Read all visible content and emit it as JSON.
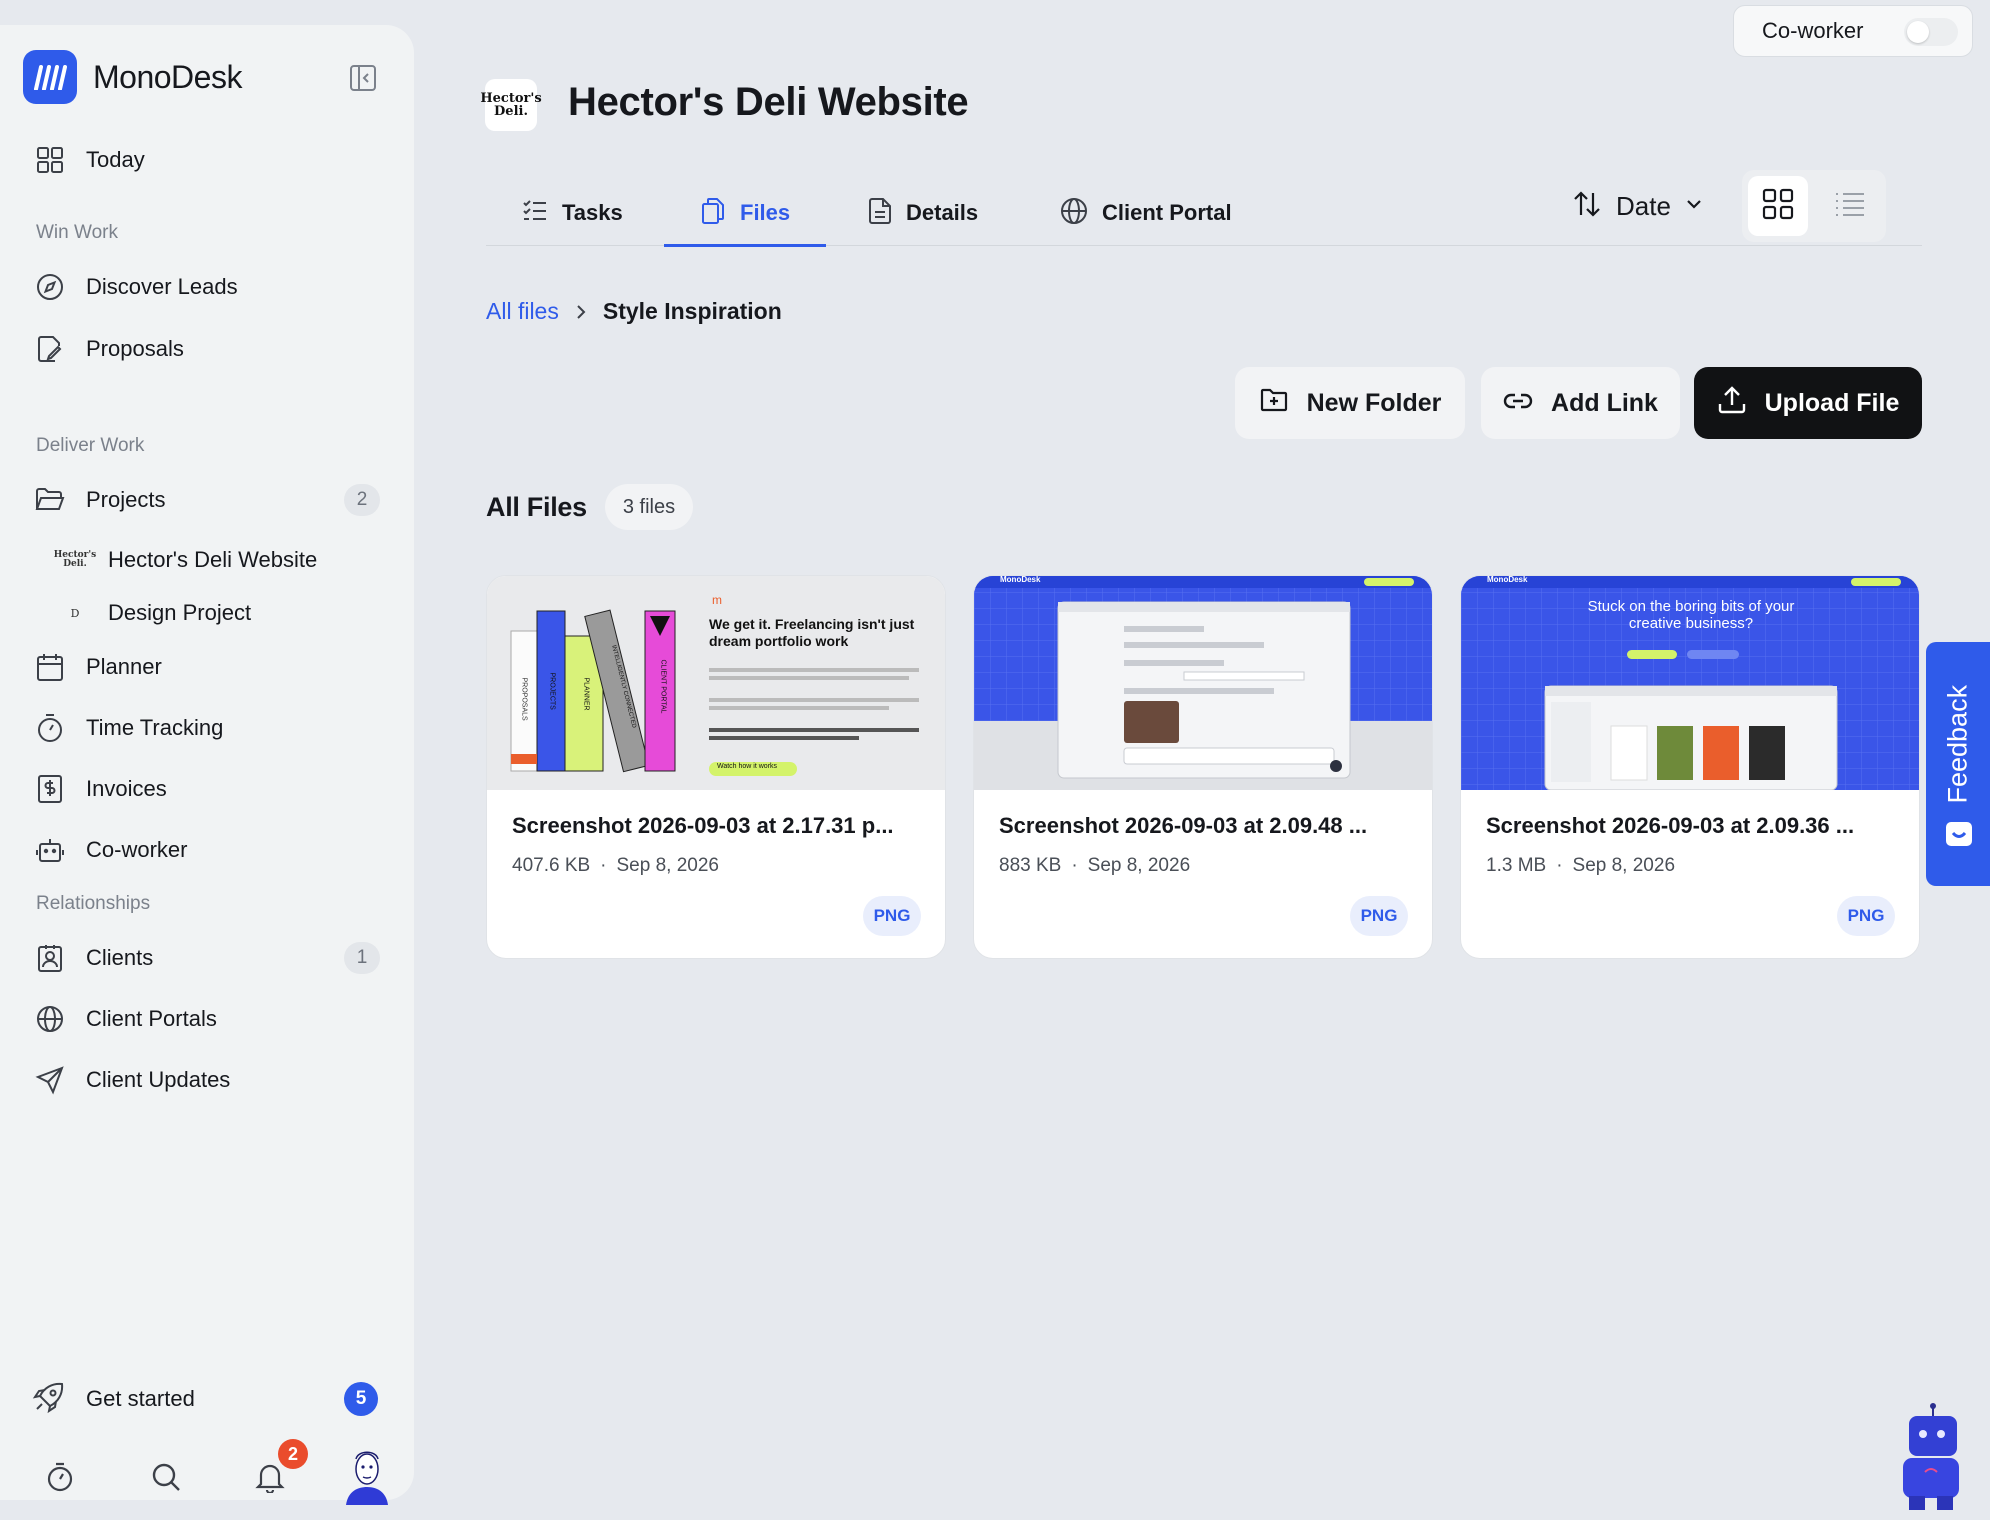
{
  "app": {
    "name": "MonoDesk",
    "brand_color": "#2f5bea"
  },
  "sidebar": {
    "today": "Today",
    "sections": {
      "win": "Win Work",
      "deliver": "Deliver Work",
      "relationships": "Relationships"
    },
    "items": {
      "discover": "Discover Leads",
      "proposals": "Proposals",
      "projects": "Projects",
      "projects_count": "2",
      "planner": "Planner",
      "time": "Time Tracking",
      "invoices": "Invoices",
      "coworker": "Co-worker",
      "clients": "Clients",
      "clients_count": "1",
      "portals": "Client Portals",
      "updates": "Client Updates"
    },
    "subprojects": [
      {
        "label": "Hector's Deli Website",
        "mini": "Hector's Deli."
      },
      {
        "label": "Design Project",
        "mini": "D"
      }
    ],
    "get_started": {
      "label": "Get started",
      "count": "5"
    },
    "notifications_count": "2"
  },
  "coworker_toggle": {
    "label": "Co-worker",
    "on": false
  },
  "project": {
    "title": "Hector's Deli Website",
    "logo_text": "Hector's Deli."
  },
  "tabs": [
    {
      "label": "Tasks",
      "active": false
    },
    {
      "label": "Files",
      "active": true
    },
    {
      "label": "Details",
      "active": false
    },
    {
      "label": "Client Portal",
      "active": false
    }
  ],
  "sort": {
    "label": "Date"
  },
  "breadcrumb": {
    "root": "All files",
    "current": "Style Inspiration"
  },
  "actions": {
    "new_folder": "New Folder",
    "add_link": "Add Link",
    "upload": "Upload File"
  },
  "files_header": {
    "title": "All Files",
    "count": "3 files"
  },
  "files": [
    {
      "name": "Screenshot 2026-09-03 at 2.17.31 p...",
      "size": "407.6 KB",
      "date": "Sep 8, 2026",
      "type": "PNG"
    },
    {
      "name": "Screenshot 2026-09-03 at 2.09.48 ...",
      "size": "883 KB",
      "date": "Sep 8, 2026",
      "type": "PNG"
    },
    {
      "name": "Screenshot 2026-09-03 at 2.09.36 ...",
      "size": "1.3 MB",
      "date": "Sep 8, 2026",
      "type": "PNG"
    }
  ],
  "thumbs": {
    "t1": {
      "headline": "We get it. Freelancing isn't just dream portfolio work",
      "cta": "Watch how it works",
      "spines": [
        "PROPOSALS",
        "PROJECTS",
        "PLANNER",
        "INTELLIGENTLY CONNECTED",
        "CLIENT PORTAL"
      ]
    },
    "t3": {
      "headline": "Stuck on the boring bits of your creative business?",
      "brand": "MonoDesk"
    },
    "t2": {
      "brand": "MonoDesk"
    }
  },
  "feedback": {
    "label": "Feedback"
  }
}
